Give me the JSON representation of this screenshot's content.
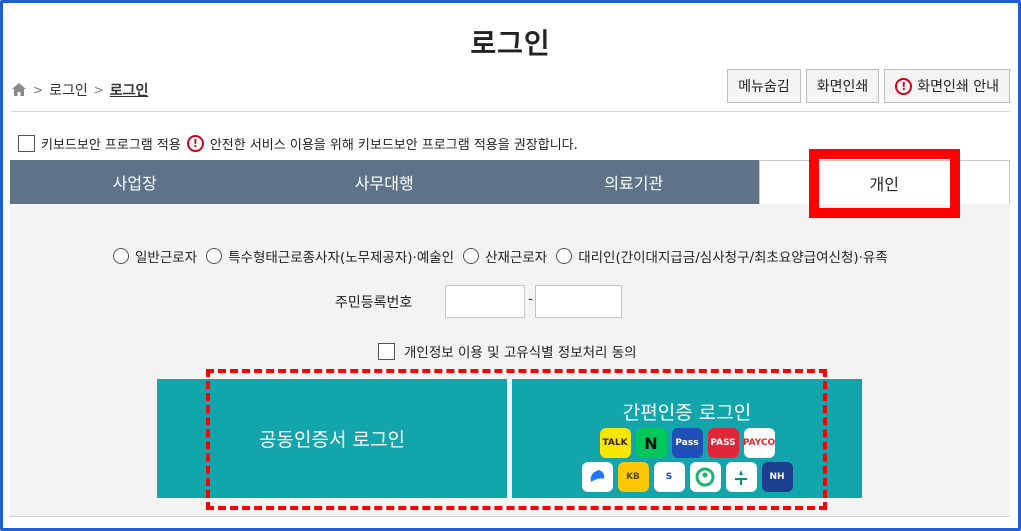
{
  "page": {
    "title": "로그인"
  },
  "breadcrumb": {
    "items": [
      "로그인",
      "로그인"
    ]
  },
  "toolbar": {
    "hide_menu": "메뉴숨김",
    "print": "화면인쇄",
    "print_guide": "화면인쇄 안내"
  },
  "keyboard": {
    "label": "키보드보안 프로그램 적용",
    "notice": "안전한 서비스 이용을 위해 키보드보안 프로그램 적용을 권장합니다."
  },
  "tabs": [
    {
      "label": "사업장",
      "active": false
    },
    {
      "label": "사무대행",
      "active": false
    },
    {
      "label": "의료기관",
      "active": false
    },
    {
      "label": "개인",
      "active": true
    }
  ],
  "radios": [
    "일반근로자",
    "특수형태근로종사자(노무제공자)·예술인",
    "산재근로자",
    "대리인(간이대지급금/심사청구/최초요양급여신청)·유족"
  ],
  "rrn": {
    "label": "주민등록번호",
    "dash": "-"
  },
  "consent": {
    "label": "개인정보 이용 및 고유식별 정보처리 동의"
  },
  "login": {
    "cert_label": "공동인증서 로그인",
    "simple_label": "간편인증 로그인",
    "providers_row1": [
      {
        "name": "kakao-icon",
        "text": "TALK",
        "bg": "#f7e600",
        "fg": "#3b1e1e"
      },
      {
        "name": "naver-icon",
        "text": "N",
        "bg": "#03c75a",
        "fg": "#111111"
      },
      {
        "name": "samsung-pass-icon",
        "text": "Pass",
        "bg": "#1f4fb8",
        "fg": "#ffffff"
      },
      {
        "name": "pass-icon",
        "text": "PASS",
        "bg": "#e2263a",
        "fg": "#ffffff"
      },
      {
        "name": "payco-icon",
        "text": "PAYCO",
        "bg": "#ffffff",
        "fg": "#e3242b"
      }
    ],
    "providers_row2": [
      {
        "name": "toss-icon",
        "text": "",
        "bg": "#ffffff",
        "fg": "#1e78ff"
      },
      {
        "name": "kb-icon",
        "text": "KB",
        "bg": "#fcc800",
        "fg": "#5a4a2a"
      },
      {
        "name": "shinhan-icon",
        "text": "S",
        "bg": "#ffffff",
        "fg": "#0046ff"
      },
      {
        "name": "greencert-icon",
        "text": "",
        "bg": "#ffffff",
        "fg": "#1db36b"
      },
      {
        "name": "hana-icon",
        "text": "",
        "bg": "#ffffff",
        "fg": "#00917c"
      },
      {
        "name": "nh-icon",
        "text": "NH",
        "bg": "#1d3f8f",
        "fg": "#ffffff"
      }
    ]
  },
  "colors": {
    "tab_bg": "#5f7388",
    "teal": "#12a5ab",
    "highlight": "#ff0000",
    "frame": "#1e5fd6"
  }
}
